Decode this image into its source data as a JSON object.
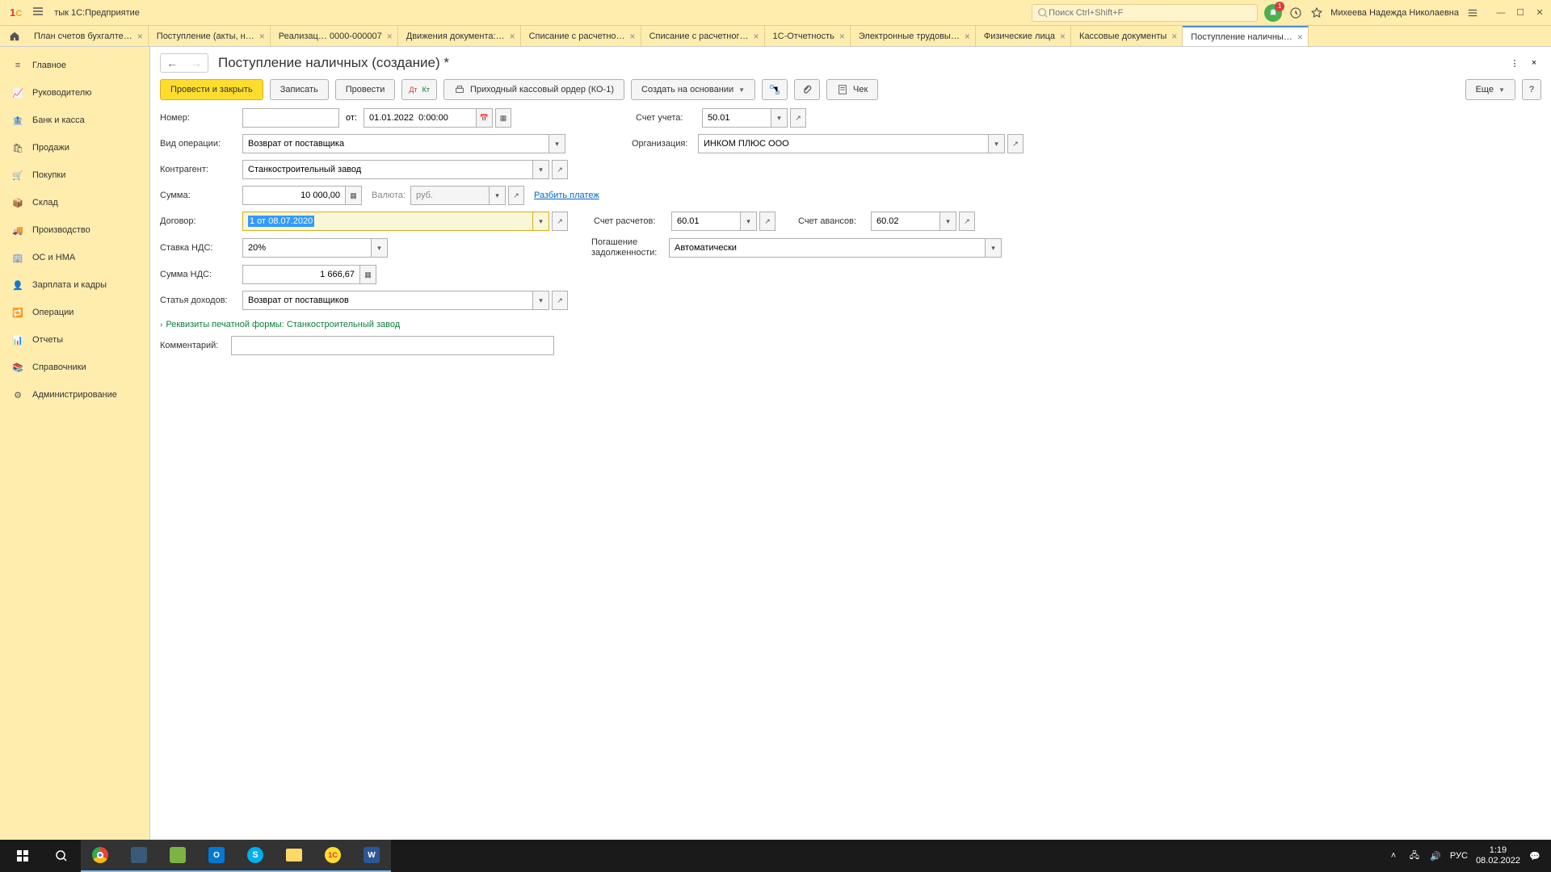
{
  "app": {
    "title": "тык 1С:Предприятие",
    "search_placeholder": "Поиск Ctrl+Shift+F",
    "user": "Михеева Надежда Николаевна"
  },
  "tabs": [
    {
      "label": "План счетов бухгалте…"
    },
    {
      "label": "Поступление (акты, н…"
    },
    {
      "label": "Реализац… 0000-000007"
    },
    {
      "label": "Движения документа:…"
    },
    {
      "label": "Списание с расчетно…"
    },
    {
      "label": "Списание с расчетног…"
    },
    {
      "label": "1С-Отчетность"
    },
    {
      "label": "Электронные трудовы…"
    },
    {
      "label": "Физические лица"
    },
    {
      "label": "Кассовые документы"
    },
    {
      "label": "Поступление наличны…",
      "active": true
    }
  ],
  "sidebar": [
    {
      "icon": "home",
      "label": "Главное"
    },
    {
      "icon": "chart",
      "label": "Руководителю"
    },
    {
      "icon": "bank",
      "label": "Банк и касса"
    },
    {
      "icon": "cart",
      "label": "Продажи"
    },
    {
      "icon": "basket",
      "label": "Покупки"
    },
    {
      "icon": "box",
      "label": "Склад"
    },
    {
      "icon": "truck",
      "label": "Производство"
    },
    {
      "icon": "building",
      "label": "ОС и НМА"
    },
    {
      "icon": "person",
      "label": "Зарплата и кадры"
    },
    {
      "icon": "ops",
      "label": "Операции"
    },
    {
      "icon": "bars",
      "label": "Отчеты"
    },
    {
      "icon": "book",
      "label": "Справочники"
    },
    {
      "icon": "gear",
      "label": "Администрирование"
    }
  ],
  "page": {
    "title": "Поступление наличных (создание) *",
    "more": "Еще"
  },
  "toolbar": {
    "post_close": "Провести и закрыть",
    "save": "Записать",
    "post": "Провести",
    "pko": "Приходный кассовый ордер (КО-1)",
    "create_based": "Создать на основании",
    "check": "Чек"
  },
  "form": {
    "number_label": "Номер:",
    "number": "",
    "from_label": "от:",
    "date": "01.01.2022  0:00:00",
    "account_label": "Счет учета:",
    "account": "50.01",
    "op_type_label": "Вид операции:",
    "op_type": "Возврат от поставщика",
    "org_label": "Организация:",
    "org": "ИНКОМ ПЛЮС ООО",
    "contragent_label": "Контрагент:",
    "contragent": "Станкостроительный завод",
    "amount_label": "Сумма:",
    "amount": "10 000,00",
    "currency_label": "Валюта:",
    "currency": "руб.",
    "split_link": "Разбить платеж",
    "contract_label": "Договор:",
    "contract": "1 от 08.07.2020",
    "calc_account_label": "Счет расчетов:",
    "calc_account": "60.01",
    "advance_account_label": "Счет авансов:",
    "advance_account": "60.02",
    "vat_rate_label": "Ставка НДС:",
    "vat_rate": "20%",
    "debt_label1": "Погашение",
    "debt_label2": "задолженности:",
    "debt": "Автоматически",
    "vat_amount_label": "Сумма НДС:",
    "vat_amount": "1 666,67",
    "income_label": "Статья доходов:",
    "income": "Возврат от поставщиков",
    "expander": "Реквизиты печатной формы: Станкостроительный завод",
    "comment_label": "Комментарий:",
    "comment": ""
  },
  "taskbar": {
    "time": "1:19",
    "date": "08.02.2022",
    "lang": "РУС"
  }
}
